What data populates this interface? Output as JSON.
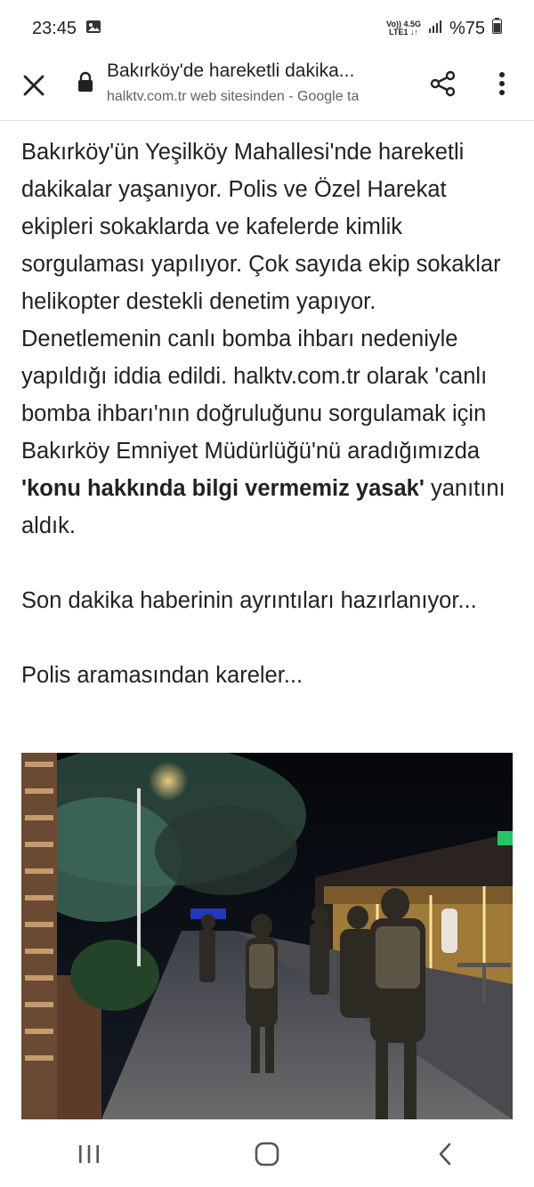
{
  "status": {
    "time": "23:45",
    "network_top": "Vo)) 4.5G",
    "network_bottom": "LTE1 ↓↑",
    "battery": "%75"
  },
  "toolbar": {
    "title": "Bakırköy'de hareketli dakika...",
    "subtitle": "halktv.com.tr web sitesinden - Google ta"
  },
  "article": {
    "paragraph1_before": "Bakırköy'ün Yeşilköy Mahallesi'nde hareketli dakikalar yaşanıyor. Polis ve Özel Harekat ekipleri sokaklarda ve kafelerde kimlik sorgulaması yapılıyor. Çok sayıda ekip sokaklar helikopter destekli denetim yapıyor. Denetlemenin canlı bomba ihbarı nedeniyle yapıldığı iddia edildi. halktv.com.tr olarak 'canlı bomba ihbarı'nın doğruluğunu sorgulamak için Bakırköy Emniyet Müdürlüğü'nü aradığımızda ",
    "paragraph1_bold": "'konu hakkında bilgi vermemiz yasak'",
    "paragraph1_after": " yanıtını aldık.",
    "paragraph2": "Son dakika haberinin ayrıntıları hazırlanıyor...",
    "paragraph3": "Polis aramasından kareler..."
  },
  "icons": {
    "close": "close-icon",
    "lock": "lock-icon",
    "share": "share-icon",
    "more": "more-vert-icon",
    "recents": "recents-icon",
    "home": "home-icon",
    "back": "back-icon"
  }
}
